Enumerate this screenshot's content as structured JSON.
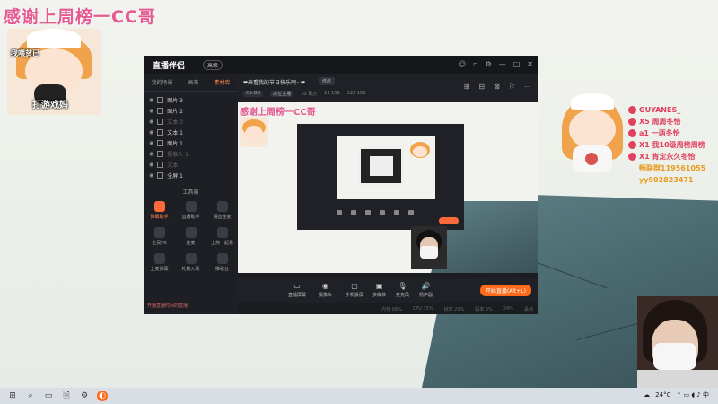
{
  "overlay": {
    "title": "感谢上周榜一CC哥",
    "sticker_label": "打游戏妈",
    "sticker_top_label": "我喂贫已"
  },
  "rank_list": [
    {
      "text": "GUYANES_"
    },
    {
      "text": "X5 周周冬怡"
    },
    {
      "text": "a1 一两冬怡"
    },
    {
      "text": "X1 我10级周榜周榜"
    },
    {
      "text": "X1 肯定永久冬怡"
    },
    {
      "text": "畅联群119561055"
    },
    {
      "text": "yy902823471"
    }
  ],
  "app": {
    "logo": "直播伴侣",
    "badge": "高级",
    "window_controls": [
      "☺",
      "▫",
      "⚙",
      "—",
      "□",
      "✕"
    ],
    "left_tabs": [
      {
        "label": "我的场景",
        "active": false
      },
      {
        "label": "画布",
        "active": false
      },
      {
        "label": "素材库",
        "active": true
      }
    ],
    "scenes": [
      {
        "label": "图片 3",
        "dim": false
      },
      {
        "label": "图片 2",
        "dim": false
      },
      {
        "label": "文本 3",
        "dim": true
      },
      {
        "label": "文本 1",
        "dim": false
      },
      {
        "label": "图片 1",
        "dim": false
      },
      {
        "label": "摄像头 1",
        "dim": true
      },
      {
        "label": "文本",
        "dim": true
      },
      {
        "label": "全屏 1",
        "dim": false
      }
    ],
    "tools_title": "工具箱",
    "tools": [
      {
        "label": "弹幕助手",
        "hot": true
      },
      {
        "label": "直播助手",
        "hot": false
      },
      {
        "label": "语音连麦",
        "hot": false
      },
      {
        "label": "全民PK",
        "hot": false
      },
      {
        "label": "连麦",
        "hot": false
      },
      {
        "label": "上热一起看",
        "hot": false
      },
      {
        "label": "上麦弹幕",
        "hot": false
      },
      {
        "label": "礼物入场",
        "hot": false
      },
      {
        "label": "推歌台",
        "hot": false
      }
    ],
    "footer": "开播直播时间的直播",
    "stream_title": "❤来看我的节日快乐啊~❤",
    "edit_label": "修改",
    "stats": [
      "CS:GO",
      "高位主播",
      "10 百万",
      "13 156",
      "129 163"
    ],
    "head_icons": [
      "⊞",
      "⊟",
      "⊠",
      "⚐",
      "⋯"
    ],
    "preview_title": "感谢上周榜一CC哥",
    "bottom_tools": [
      {
        "label": "直播屏幕",
        "icon": "▭"
      },
      {
        "label": "摄像头",
        "icon": "◉"
      },
      {
        "label": "手机投屏",
        "icon": "▢"
      },
      {
        "label": "多媒体",
        "icon": "▣"
      },
      {
        "label": "麦克风",
        "icon": "🎙"
      },
      {
        "label": "扬声器",
        "icon": "🔊"
      }
    ],
    "go_live": "开始直播(Alt+L)",
    "status": [
      "内存 08%",
      "CPU 15%",
      "帧率 20%",
      "码率 6%",
      "24%",
      "丢帧"
    ]
  },
  "taskbar": {
    "weather": "24°C",
    "time": "",
    "icons": [
      "⊞",
      "⌕",
      "▭",
      "🗎",
      "⚙",
      "◐"
    ]
  }
}
